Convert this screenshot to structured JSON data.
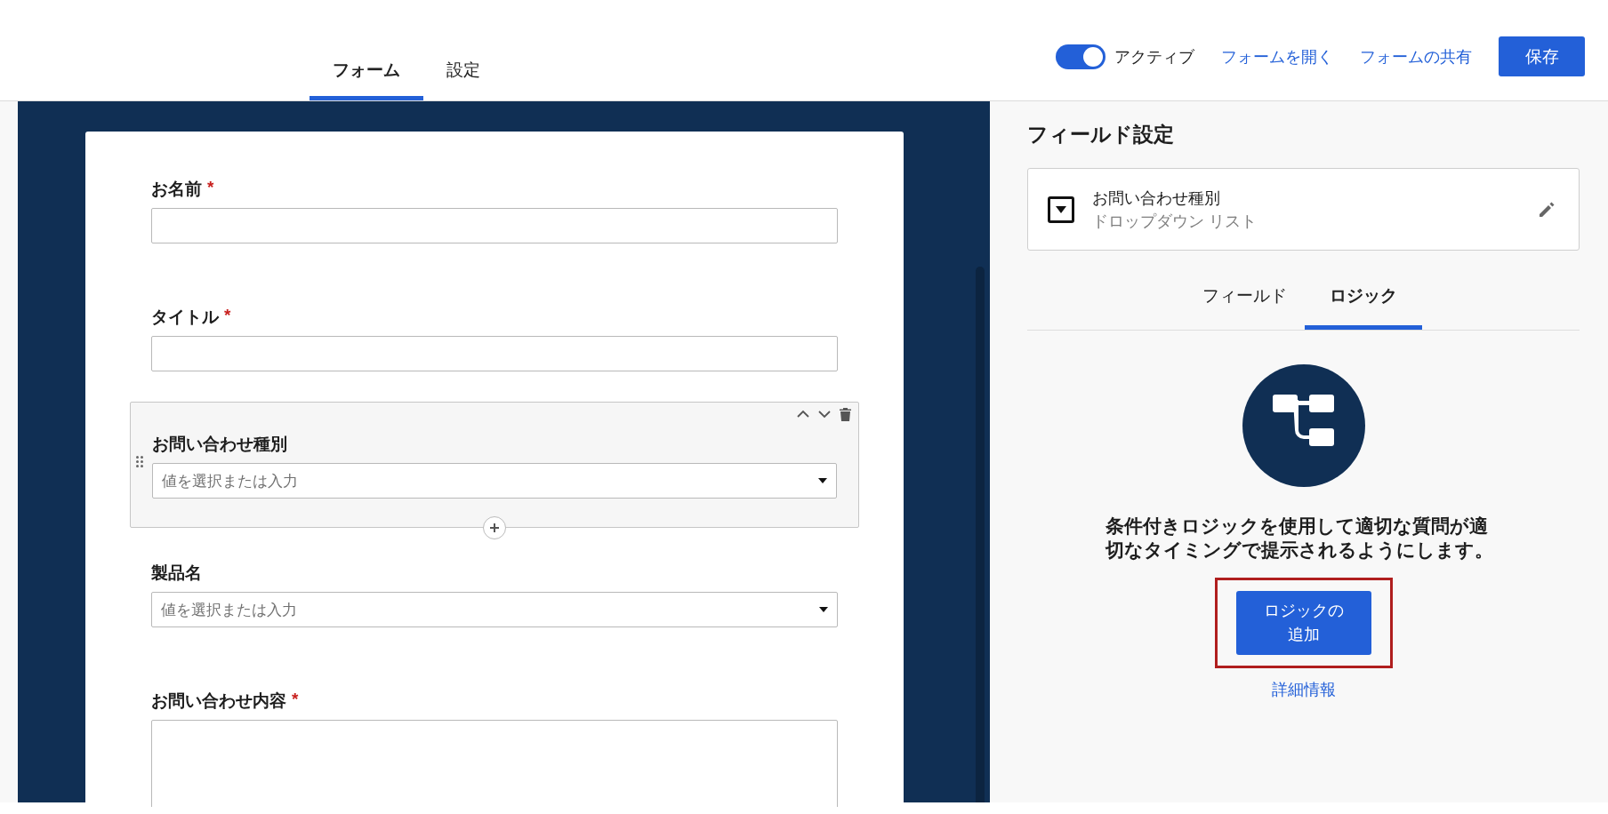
{
  "header": {
    "tabs": [
      {
        "label": "フォーム",
        "selected": true
      },
      {
        "label": "設定",
        "selected": false
      }
    ],
    "toggle": {
      "label": "アクティブ",
      "on": true
    },
    "links": [
      "フォームを開く",
      "フォームの共有"
    ],
    "save_button": "保存"
  },
  "form": {
    "fields": [
      {
        "label": "お名前",
        "required_mark": "*",
        "kind": "text",
        "selected": false
      },
      {
        "label": "タイトル",
        "required_mark": "*",
        "kind": "text",
        "selected": false
      },
      {
        "label": "お問い合わせ種別",
        "kind": "dropdown",
        "placeholder": "値を選択または入力",
        "selected": true
      },
      {
        "label": "製品名",
        "kind": "dropdown",
        "placeholder": "値を選択または入力",
        "selected": false
      },
      {
        "label": "お問い合わせ内容",
        "required_mark": "*",
        "kind": "textarea",
        "selected": false
      }
    ]
  },
  "panel": {
    "title": "フィールド設定",
    "field_card": {
      "name": "お問い合わせ種別",
      "type": "ドロップダウン リスト"
    },
    "tabs": [
      {
        "label": "フィールド",
        "selected": false
      },
      {
        "label": "ロジック",
        "selected": true
      }
    ],
    "logic": {
      "description": "条件付きロジックを使用して適切な質問が適切なタイミングで提示されるようにします。",
      "add_button": "ロジックの追加",
      "highlighted": true,
      "learn_more": "詳細情報"
    }
  }
}
